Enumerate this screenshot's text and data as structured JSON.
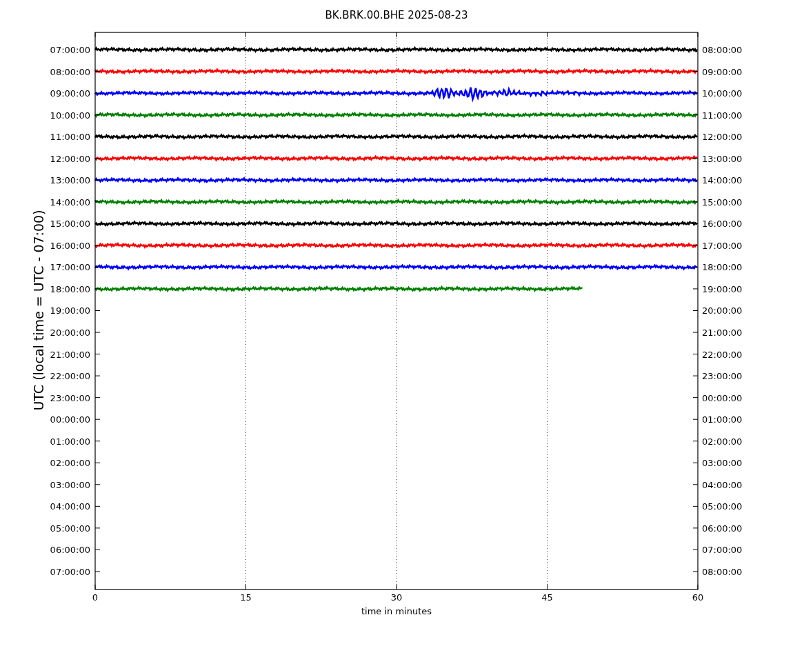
{
  "title": "BK.BRK.00.BHE 2025-08-23",
  "ylabel": "UTC (local time = UTC - 07:00)",
  "xlabel": "time in minutes",
  "xticks": [
    "0",
    "15",
    "30",
    "45",
    "60"
  ],
  "left_labels": [
    "07:00:00",
    "08:00:00",
    "09:00:00",
    "10:00:00",
    "11:00:00",
    "12:00:00",
    "13:00:00",
    "14:00:00",
    "15:00:00",
    "16:00:00",
    "17:00:00",
    "18:00:00",
    "19:00:00",
    "20:00:00",
    "21:00:00",
    "22:00:00",
    "23:00:00",
    "00:00:00",
    "01:00:00",
    "02:00:00",
    "03:00:00",
    "04:00:00",
    "05:00:00",
    "06:00:00",
    "07:00:00"
  ],
  "right_labels": [
    "08:00:00",
    "09:00:00",
    "10:00:00",
    "11:00:00",
    "12:00:00",
    "13:00:00",
    "14:00:00",
    "15:00:00",
    "16:00:00",
    "17:00:00",
    "18:00:00",
    "19:00:00",
    "20:00:00",
    "21:00:00",
    "22:00:00",
    "23:00:00",
    "00:00:00",
    "01:00:00",
    "02:00:00",
    "03:00:00",
    "04:00:00",
    "05:00:00",
    "06:00:00",
    "07:00:00",
    "08:00:00"
  ],
  "traces": [
    {
      "color": "#000000",
      "level": 1,
      "event": false
    },
    {
      "color": "#ff0000",
      "level": 1,
      "event": false
    },
    {
      "color": "#0000ff",
      "level": 1,
      "event": true
    },
    {
      "color": "#008000",
      "level": 1,
      "event": false
    },
    {
      "color": "#000000",
      "level": 1,
      "event": false
    },
    {
      "color": "#ff0000",
      "level": 1,
      "event": false
    },
    {
      "color": "#0000ff",
      "level": 1,
      "event": false
    },
    {
      "color": "#008000",
      "level": 1,
      "event": false
    },
    {
      "color": "#000000",
      "level": 1,
      "event": false
    },
    {
      "color": "#ff0000",
      "level": 1,
      "event": false
    },
    {
      "color": "#0000ff",
      "level": 1,
      "event": false
    },
    {
      "color": "#008000",
      "level": 0.81,
      "event": false
    }
  ]
}
